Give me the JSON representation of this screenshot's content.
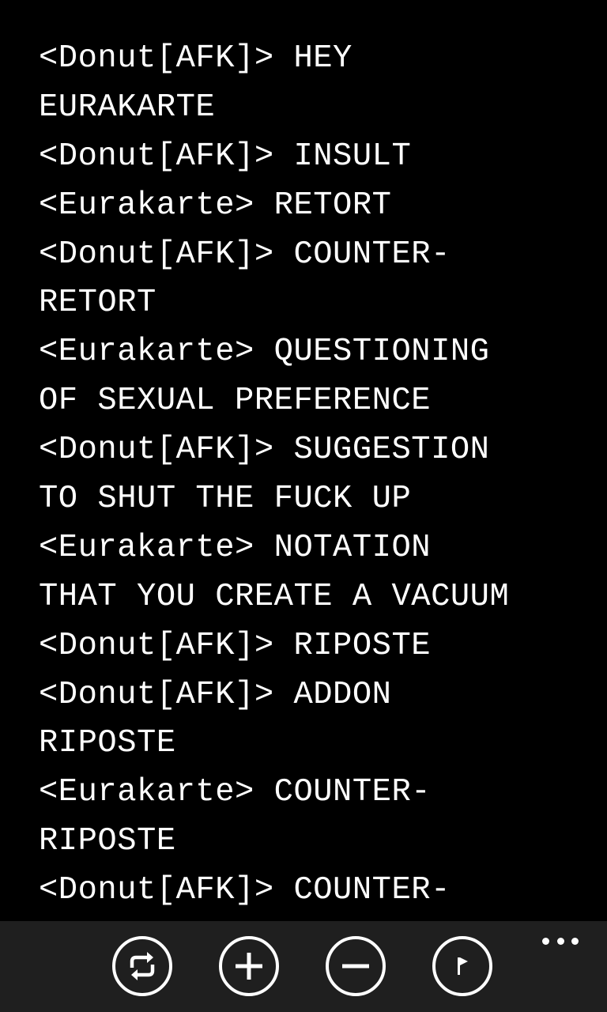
{
  "lines": [
    "<Donut[AFK]> HEY",
    "EURAKARTE",
    "<Donut[AFK]> INSULT",
    "<Eurakarte> RETORT",
    "<Donut[AFK]> COUNTER-",
    "RETORT",
    "<Eurakarte> QUESTIONING",
    "OF SEXUAL PREFERENCE",
    "<Donut[AFK]> SUGGESTION",
    "TO SHUT THE FUCK UP",
    "<Eurakarte> NOTATION",
    "THAT YOU CREATE A VACUUM",
    "<Donut[AFK]> RIPOSTE",
    "<Donut[AFK]> ADDON",
    "RIPOSTE",
    "<Eurakarte> COUNTER-",
    "RIPOSTE",
    "<Donut[AFK]> COUNTER-"
  ],
  "appbar": {
    "buttons": [
      {
        "icon": "refresh-icon"
      },
      {
        "icon": "plus-icon"
      },
      {
        "icon": "minus-icon"
      },
      {
        "icon": "flag-icon"
      }
    ],
    "more_icon": "ellipsis-icon"
  },
  "colors": {
    "background": "#000000",
    "text": "#ffffff",
    "appbar": "#1f1f1f"
  }
}
